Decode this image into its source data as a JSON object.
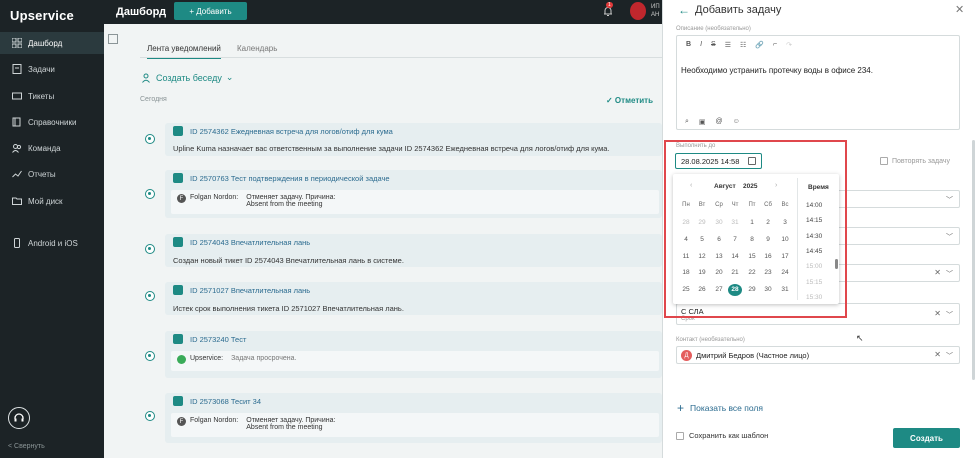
{
  "app": {
    "logo": "Upservice",
    "page_title": "Дашборд",
    "add_button": "+ Добавить",
    "notification_count": "1",
    "org_name_line1": "ИП",
    "org_name_line2": "АН"
  },
  "sidebar": {
    "items": [
      {
        "label": "Дашборд",
        "icon": "dashboard-icon"
      },
      {
        "label": "Задачи",
        "icon": "tasks-icon"
      },
      {
        "label": "Тикеты",
        "icon": "tickets-icon"
      },
      {
        "label": "Справочники",
        "icon": "directory-icon"
      },
      {
        "label": "Команда",
        "icon": "team-icon"
      },
      {
        "label": "Отчеты",
        "icon": "reports-icon"
      },
      {
        "label": "Мой диск",
        "icon": "folder-icon"
      },
      {
        "label": "Android и iOS",
        "icon": "mobile-icon"
      }
    ],
    "collapse_label": "< Свернуть"
  },
  "feed": {
    "tabs": [
      "Лента уведомлений",
      "Календарь"
    ],
    "create_chat": "Создать беседу",
    "today_label": "Сегодня",
    "mark_all": "✓ Отметить",
    "cards": [
      {
        "title": "ID 2574362 Ежедневная встреча для логов/отиф для кума",
        "body": "Upline Kuma назначает вас ответственным за выполнение задачи ID 2574362 Ежедневная встреча для логов/отиф для кума."
      },
      {
        "title": "ID 2570763 Тест подтверждения в периодической задаче",
        "author": "Folgan Nordon:",
        "text1": "Отменяет задачу. Причина:",
        "text2": "Absent from the meeting"
      },
      {
        "title": "ID 2574043 Впечатлительная лань",
        "body": "Создан новый тикет ID 2574043 Впечатлительная лань в системе."
      },
      {
        "title": "ID 2571027 Впечатлительная лань",
        "body": "Истек срок выполнения тикета ID 2571027 Впечатлительная лань."
      },
      {
        "title": "ID 2573240 Тест",
        "author": "Upservice:",
        "text1": "Задача просрочена."
      },
      {
        "title": "ID 2573068 Тесит 34",
        "author": "Folgan Nordon:",
        "text1": "Отменяет задачу. Причина:",
        "text2": "Absent from the meeting"
      }
    ]
  },
  "panel": {
    "title": "Добавить задачу",
    "description_label": "Описание (необязательно)",
    "toolbar": [
      "B",
      "I",
      "S",
      "☰",
      "☷",
      "🔗",
      "⌐",
      "↷"
    ],
    "description_text": "Необходимо устранить протечку воды в офисе 234.",
    "due_label": "Выполнить до",
    "due_value": "28.08.2025 14:58",
    "repeat_label": "Повторять задачу",
    "sla_label": "С СЛА",
    "sla_sub": "Срок",
    "contact_label": "Контакт (необязательно)",
    "contact_initial": "Д",
    "contact_value": "Дмитрий Бедров (Частное лицо)",
    "show_all": "Показать все поля",
    "save_template": "Сохранить как шаблон",
    "create_button": "Создать"
  },
  "datepicker": {
    "month": "Август",
    "year": "2025",
    "time_header": "Время",
    "weekdays": [
      "Пн",
      "Вт",
      "Ср",
      "Чт",
      "Пт",
      "Сб",
      "Вс"
    ],
    "weeks": [
      [
        "28",
        "29",
        "30",
        "31",
        "1",
        "2",
        "3"
      ],
      [
        "4",
        "5",
        "6",
        "7",
        "8",
        "9",
        "10"
      ],
      [
        "11",
        "12",
        "13",
        "14",
        "15",
        "16",
        "17"
      ],
      [
        "18",
        "19",
        "20",
        "21",
        "22",
        "23",
        "24"
      ],
      [
        "25",
        "26",
        "27",
        "28",
        "29",
        "30",
        "31"
      ]
    ],
    "selected_day": "28",
    "times": [
      "14:00",
      "14:15",
      "14:30",
      "14:45",
      "15:00",
      "15:15",
      "15:30"
    ]
  }
}
